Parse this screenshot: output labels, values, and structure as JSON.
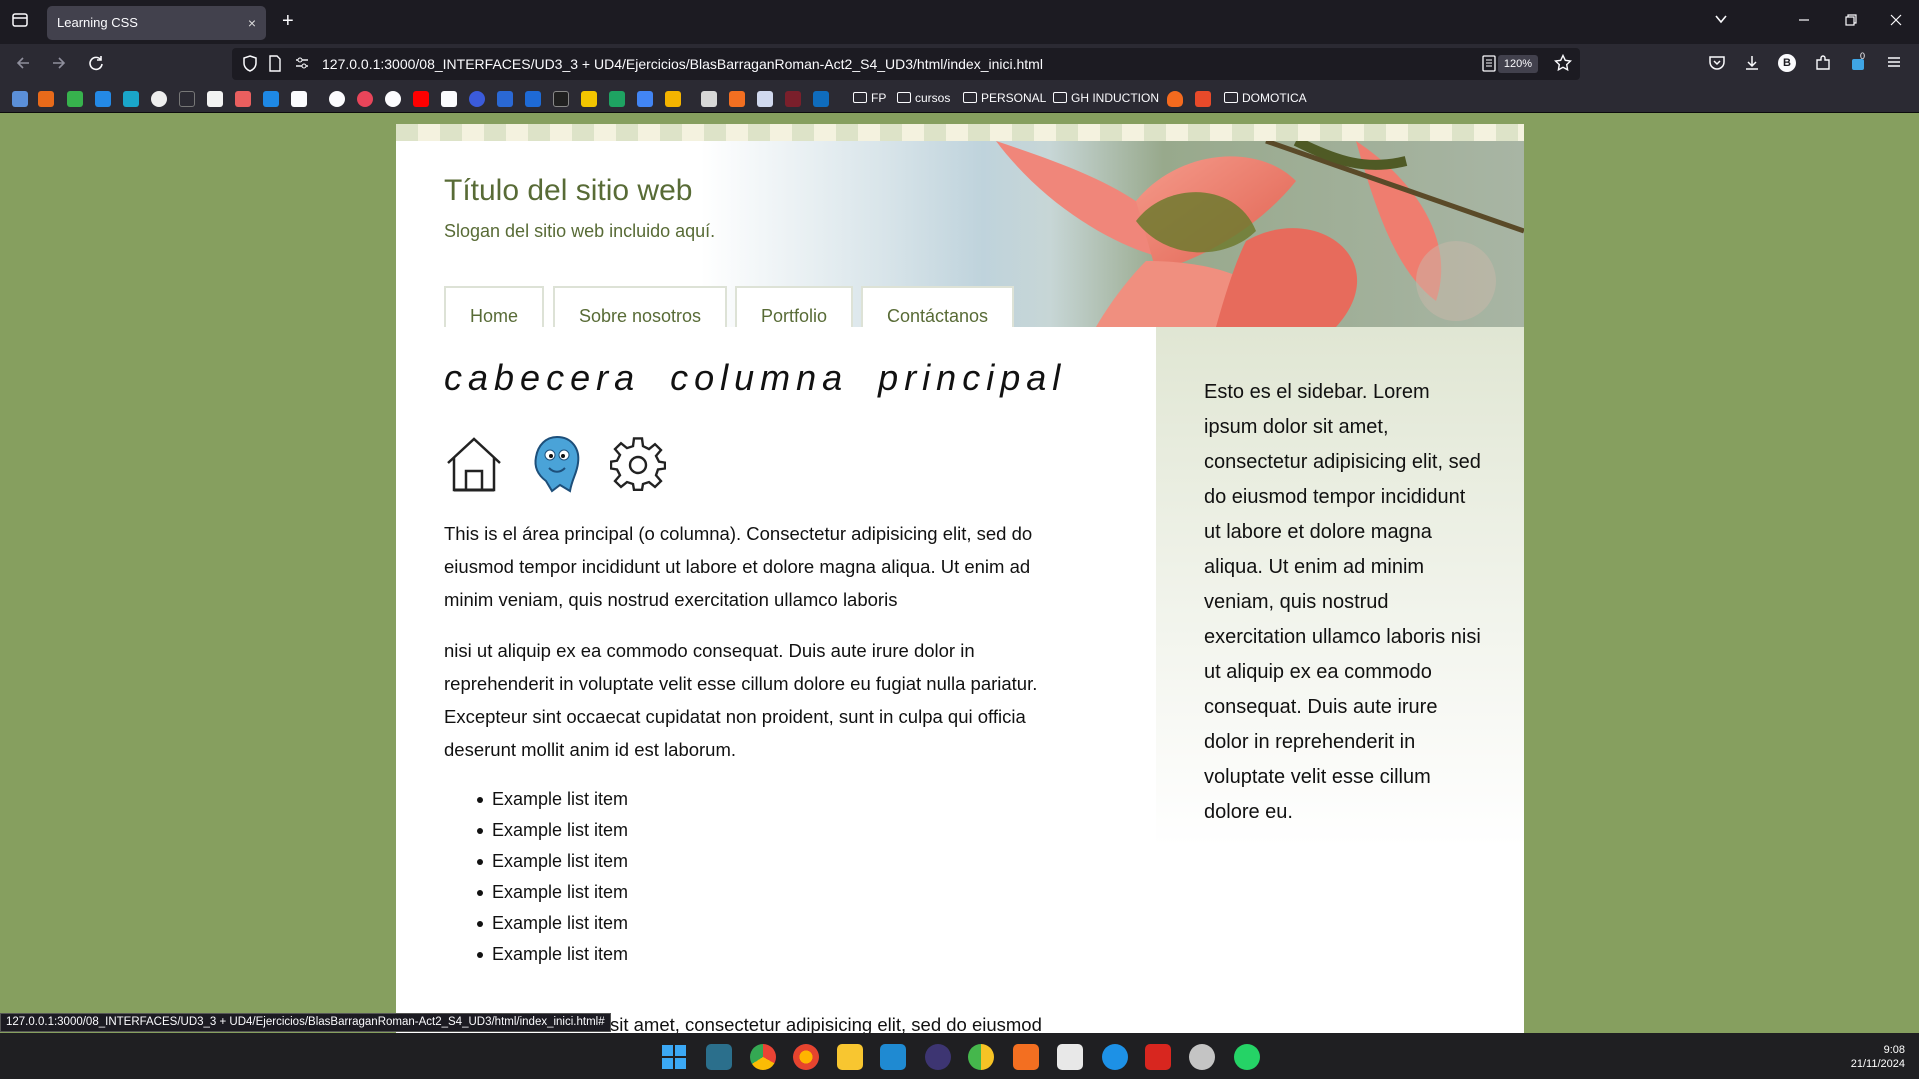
{
  "browser": {
    "tab_title": "Learning CSS",
    "tab_close": "×",
    "new_tab": "+",
    "url": "127.0.0.1:3000/08_INTERFACES/UD3_3 + UD4/Ejercicios/BlasBarraganRoman-Act2_S4_UD3/html/index_inici.html",
    "zoom": "120%",
    "profile_badge": "B",
    "extension_badge": "0"
  },
  "bookmarks": {
    "folders": [
      "FP",
      "cursos",
      "PERSONAL",
      "GH INDUCTION",
      "DOMOTICA"
    ]
  },
  "site": {
    "title": "Título del sitio web",
    "slogan": "Slogan del sitio web incluido aquí.",
    "menu": [
      "Home",
      "Sobre nosotros",
      "Portfolio",
      "Contáctanos"
    ]
  },
  "main": {
    "heading": "cabecera columna principal",
    "paragraphs": [
      "This is el área principal (o columna). Consectetur adipisicing elit, sed do eiusmod tempor incididunt ut labore et dolore magna aliqua. Ut enim ad minim veniam, quis nostrud exercitation ullamco laboris",
      "nisi ut aliquip ex ea commodo consequat. Duis aute irure dolor in reprehenderit in voluptate velit esse cillum dolore eu fugiat nulla pariatur. Excepteur sint occaecat cupidatat non proident, sunt in culpa qui officia deserunt mollit anim id est laborum."
    ],
    "list_items": [
      "Example list item",
      "Example list item",
      "Example list item",
      "Example list item",
      "Example list item",
      "Example list item"
    ],
    "tail_text": "sit amet, consectetur adipisicing elit, sed do eiusmod"
  },
  "sidebar": {
    "text": "Esto es el sidebar. Lorem ipsum dolor sit amet, consectetur adipisicing elit, sed do eiusmod tempor incididunt ut labore et dolore magna aliqua. Ut enim ad minim veniam, quis nostrud exercitation ullamco laboris nisi ut aliquip ex ea commodo consequat. Duis aute irure dolor in reprehenderit in voluptate velit esse cillum dolore eu."
  },
  "status_bar": {
    "link": "127.0.0.1:3000/08_INTERFACES/UD3_3 + UD4/Ejercicios/BlasBarraganRoman-Act2_S4_UD3/html/index_inici.html#"
  },
  "taskbar": {
    "time": "9:08",
    "date": "21/11/2024"
  },
  "colors": {
    "page_background": "#869f5f",
    "site_text": "#586b36"
  },
  "icons": [
    "home-icon",
    "blue-mascot-icon",
    "gear-icon"
  ]
}
